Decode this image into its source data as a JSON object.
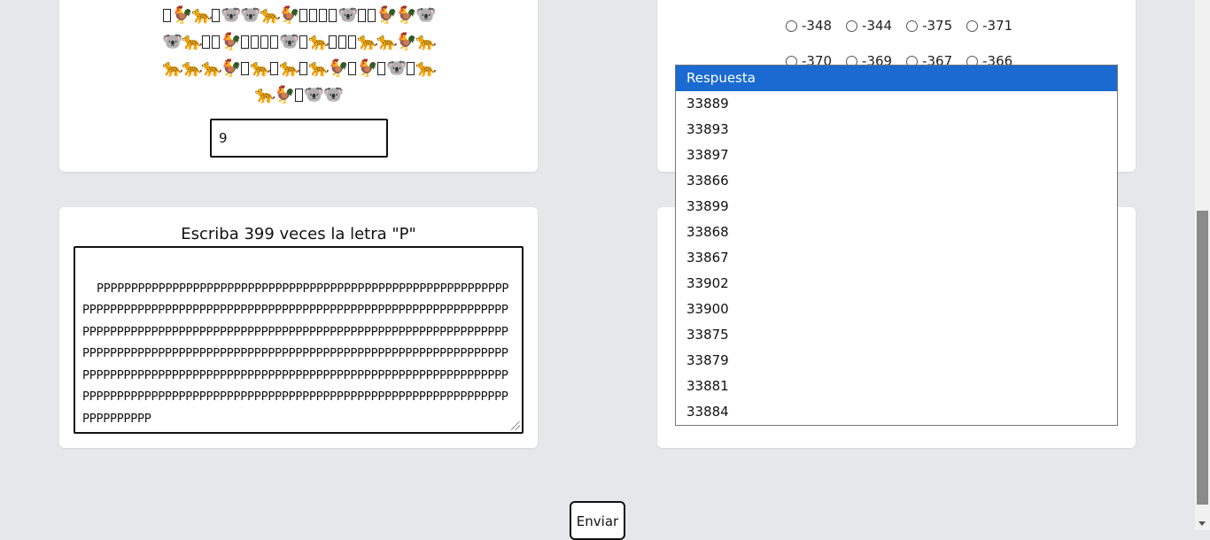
{
  "emoji_puzzle": {
    "symbols": {
      "box": "missing-glyph-box",
      "rooster": "🐓",
      "leopard": "🐆",
      "koala": "🐨"
    },
    "lines": [
      [
        "box",
        "rooster",
        "leopard",
        "box",
        "koala",
        "koala",
        "leopard",
        "rooster",
        "box",
        "box",
        "box",
        "box",
        "koala",
        "box",
        "box",
        "rooster",
        "rooster",
        "koala"
      ],
      [
        "koala",
        "leopard",
        "box",
        "box",
        "rooster",
        "box",
        "box",
        "box",
        "box",
        "koala",
        "box",
        "leopard",
        "box",
        "box",
        "box",
        "leopard",
        "leopard",
        "rooster",
        "leopard"
      ],
      [
        "leopard",
        "leopard",
        "leopard",
        "rooster",
        "box",
        "leopard",
        "box",
        "leopard",
        "box",
        "leopard",
        "rooster",
        "box",
        "rooster",
        "box",
        "koala",
        "box",
        "leopard"
      ],
      [
        "leopard",
        "rooster",
        "box",
        "koala",
        "koala"
      ]
    ],
    "answer_value": "9"
  },
  "radio_question": {
    "row1": [
      "-348",
      "-344",
      "-375",
      "-371"
    ],
    "row2": [
      "-370",
      "-369",
      "-367",
      "-366"
    ]
  },
  "text_task": {
    "prompt": "Escriba 399 veces la letra \"P\"",
    "value": "PPPPPPPPPPPPPPPPPPPPPPPPPPPPPPPPPPPPPPPPPPPPPPPPPPPPPPPPPPPPPPPPPPPPPPPPPPPPPPPPPPPPPPPPPPPPPPPPPPPPPPPPPPPPPPPPPPPPPPPPPPPPPPPPPPPPPPPPPPPPPPPPPPPPPPPPPPPPPPPPPPPPPPPPPPPPPPPPPPPPPPPPPPPPPPPPPPPPPPPPPPPPPPPPPPPPPPPPPPPPPPPPPPPPPPPPPPPPPPPPPPPPPPPPPPPPPPPPPPPPPPPPPPPPPPPPPPPPPPPPPPPPPPPPPPPPPPPPPPPPPPPPPPPPPPPPPPPPPPPPPPPPPPPPPPPPPPPPPPPPPPPPPPPPPPPPPPPPPPPPPPPPPPPPPPPPPPPPPPPP"
  },
  "dropdown": {
    "options": [
      "Respuesta",
      "33889",
      "33893",
      "33897",
      "33866",
      "33899",
      "33868",
      "33867",
      "33902",
      "33900",
      "33875",
      "33879",
      "33881",
      "33884"
    ],
    "selected": "Respuesta",
    "highlight_color": "#1a6ad1"
  },
  "submit": {
    "label": "Enviar"
  }
}
